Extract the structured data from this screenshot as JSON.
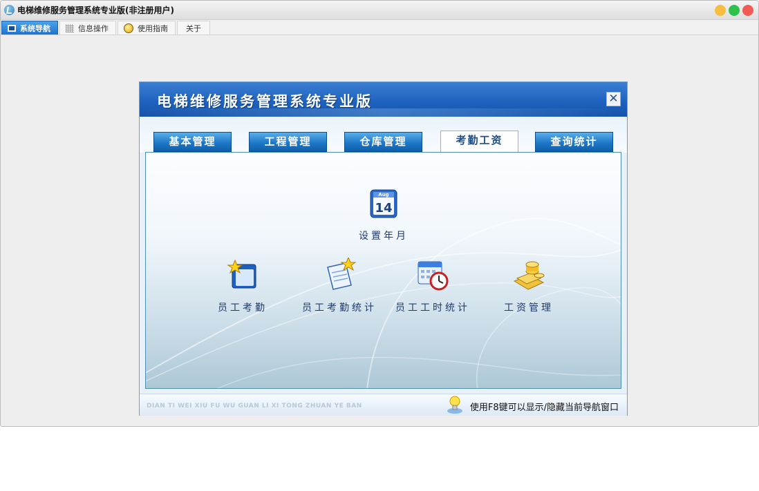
{
  "window": {
    "title": "电梯维修服务管理系统专业版(非注册用户)"
  },
  "top_tabs": [
    {
      "label": "系统导航",
      "icon": "monitor-icon",
      "active": true
    },
    {
      "label": "信息操作",
      "icon": "grid-icon",
      "active": false
    },
    {
      "label": "使用指南",
      "icon": "guide-icon",
      "active": false
    },
    {
      "label": "关于",
      "icon": "",
      "active": false
    }
  ],
  "nav_panel": {
    "title": "电梯维修服务管理系统专业版",
    "close_glyph": "✕",
    "module_tabs": [
      {
        "label": "基本管理",
        "active": false
      },
      {
        "label": "工程管理",
        "active": false
      },
      {
        "label": "仓库管理",
        "active": false
      },
      {
        "label": "考勤工资",
        "active": true
      },
      {
        "label": "查询统计",
        "active": false
      }
    ],
    "functions": [
      {
        "label": "设置年月",
        "icon": "calendar-icon",
        "calendar_month": "Aug",
        "calendar_day": "14"
      },
      {
        "label": "员工考勤",
        "icon": "folder-star-icon"
      },
      {
        "label": "员工考勤统计",
        "icon": "document-star-icon"
      },
      {
        "label": "员工工时统计",
        "icon": "calendar-clock-icon"
      },
      {
        "label": "工资管理",
        "icon": "coins-icon"
      }
    ],
    "footer": {
      "pinyin": "DIAN TI WEI XIU FU WU GUAN LI XI TONG ZHUAN YE BAN",
      "hint": "使用F8键可以显示/隐藏当前导航窗口"
    }
  },
  "colors": {
    "header_blue": "#1f63bf",
    "tab_blue": "#1e78c8",
    "active_tab_text": "#1f4e87",
    "label_text": "#1f3a6a"
  }
}
